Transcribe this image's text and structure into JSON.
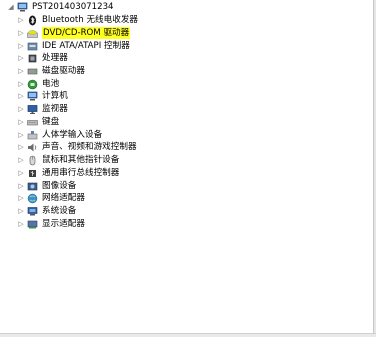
{
  "tree": {
    "root": {
      "label": "PST201403071234",
      "icon": "computer-icon",
      "expanded": true
    },
    "items": [
      {
        "label": "Bluetooth 无线电收发器",
        "icon": "bluetooth-icon",
        "highlighted": false
      },
      {
        "label": "DVD/CD-ROM 驱动器",
        "icon": "dvd-drive-icon",
        "highlighted": true
      },
      {
        "label": "IDE ATA/ATAPI 控制器",
        "icon": "ide-controller-icon",
        "highlighted": false
      },
      {
        "label": "处理器",
        "icon": "processor-icon",
        "highlighted": false
      },
      {
        "label": "磁盘驱动器",
        "icon": "disk-drive-icon",
        "highlighted": false
      },
      {
        "label": "电池",
        "icon": "battery-icon",
        "highlighted": false
      },
      {
        "label": "计算机",
        "icon": "computer-icon",
        "highlighted": false
      },
      {
        "label": "监视器",
        "icon": "monitor-icon",
        "highlighted": false
      },
      {
        "label": "键盘",
        "icon": "keyboard-icon",
        "highlighted": false
      },
      {
        "label": "人体学输入设备",
        "icon": "hid-icon",
        "highlighted": false
      },
      {
        "label": "声音、视频和游戏控制器",
        "icon": "sound-icon",
        "highlighted": false
      },
      {
        "label": "鼠标和其他指针设备",
        "icon": "mouse-icon",
        "highlighted": false
      },
      {
        "label": "通用串行总线控制器",
        "icon": "usb-icon",
        "highlighted": false
      },
      {
        "label": "图像设备",
        "icon": "imaging-device-icon",
        "highlighted": false
      },
      {
        "label": "网络适配器",
        "icon": "network-adapter-icon",
        "highlighted": false
      },
      {
        "label": "系统设备",
        "icon": "system-device-icon",
        "highlighted": false
      },
      {
        "label": "显示适配器",
        "icon": "display-adapter-icon",
        "highlighted": false
      }
    ]
  },
  "colors": {
    "highlight": "#ffff20",
    "arrow": "#7a7a7a"
  }
}
